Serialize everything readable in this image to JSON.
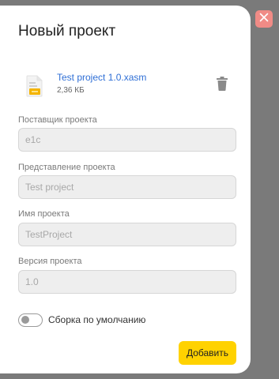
{
  "dialog": {
    "title": "Новый проект",
    "close_icon": "close-icon"
  },
  "file": {
    "name": "Test project 1.0.xasm",
    "size": "2,36 КБ",
    "icon": "file-document-icon",
    "delete_icon": "trash-icon"
  },
  "fields": {
    "supplier": {
      "label": "Поставщик проекта",
      "value": "e1c"
    },
    "presentation": {
      "label": "Представление проекта",
      "value": "Test project"
    },
    "name": {
      "label": "Имя проекта",
      "value": "TestProject"
    },
    "version": {
      "label": "Версия проекта",
      "value": "1.0"
    }
  },
  "toggle": {
    "label": "Сборка по умолчанию",
    "checked": false
  },
  "actions": {
    "submit_label": "Добавить"
  },
  "colors": {
    "accent": "#ffd200",
    "link": "#2f6fd6",
    "close_bg": "#f08b86",
    "backdrop": "#7a7a7a"
  }
}
